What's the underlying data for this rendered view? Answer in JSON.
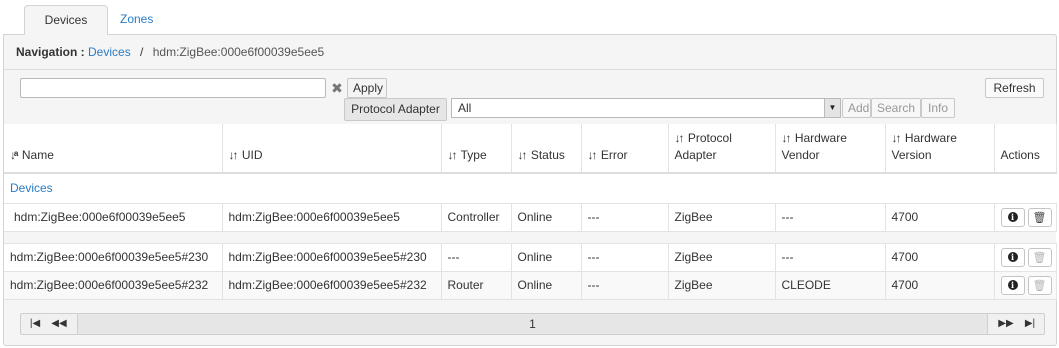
{
  "tabs": [
    {
      "label": "Devices",
      "active": true
    },
    {
      "label": "Zones",
      "active": false
    }
  ],
  "navigation": {
    "label": "Navigation :",
    "root_link": "Devices",
    "separator": "/",
    "current": "hdm:ZigBee:000e6f00039e5ee5"
  },
  "toolbar": {
    "search_value": "",
    "clear_icon": "close-icon",
    "apply_label": "Apply",
    "refresh_label": "Refresh",
    "protocol_adapter_label": "Protocol Adapter",
    "protocol_adapter_value": "All",
    "add_label": "Add",
    "search_label": "Search",
    "info_label": "Info"
  },
  "table": {
    "columns": [
      {
        "label": "Name",
        "sort_icon": "sort-alpha-icon"
      },
      {
        "label": "UID",
        "sort_icon": "sort-icon"
      },
      {
        "label": "Type",
        "sort_icon": "sort-icon"
      },
      {
        "label": "Status",
        "sort_icon": "sort-icon"
      },
      {
        "label": "Error",
        "sort_icon": "sort-icon"
      },
      {
        "label": "Protocol Adapter",
        "sort_icon": "sort-icon"
      },
      {
        "label": "Hardware Vendor",
        "sort_icon": "sort-icon"
      },
      {
        "label": "Hardware Version",
        "sort_icon": "sort-icon"
      },
      {
        "label": "Actions"
      }
    ],
    "group_label": "Devices",
    "rows": [
      {
        "name": "hdm:ZigBee:000e6f00039e5ee5",
        "uid": "hdm:ZigBee:000e6f00039e5ee5",
        "type": "Controller",
        "status": "Online",
        "error": "---",
        "protocol": "ZigBee",
        "vendor": "---",
        "version": "4700"
      },
      {
        "name": "hdm:ZigBee:000e6f00039e5ee5#230",
        "uid": "hdm:ZigBee:000e6f00039e5ee5#230",
        "type": "---",
        "status": "Online",
        "error": "---",
        "protocol": "ZigBee",
        "vendor": "---",
        "version": "4700"
      },
      {
        "name": "hdm:ZigBee:000e6f00039e5ee5#232",
        "uid": "hdm:ZigBee:000e6f00039e5ee5#232",
        "type": "Router",
        "status": "Online",
        "error": "---",
        "protocol": "ZigBee",
        "vendor": "CLEODE",
        "version": "4700"
      }
    ]
  },
  "pager": {
    "page": "1",
    "icons": [
      "first-page-icon",
      "previous-page-icon",
      "next-page-icon",
      "last-page-icon"
    ]
  },
  "colors": {
    "link": "#2a7cc7",
    "online": "#2a9a2a",
    "panel_bg": "#f5f5f5"
  }
}
